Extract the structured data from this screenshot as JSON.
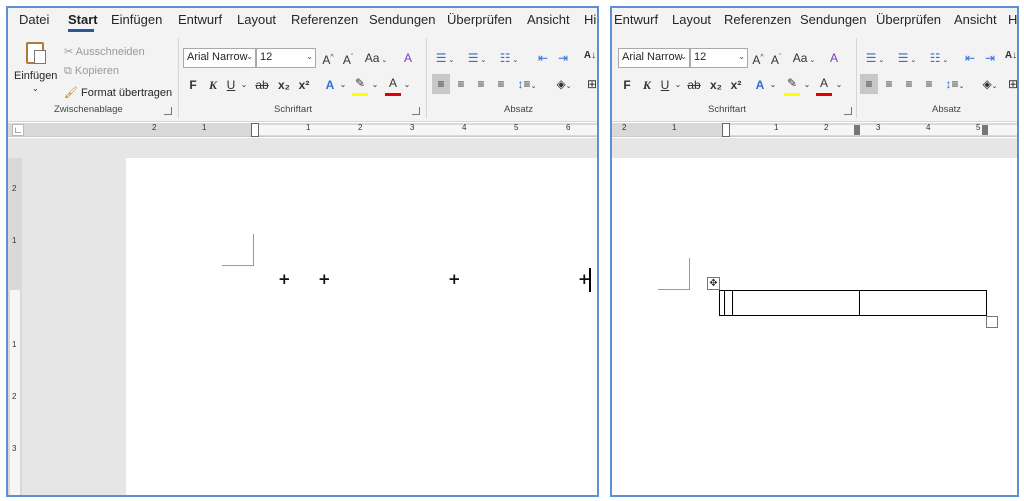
{
  "left": {
    "tabs": [
      "Datei",
      "Start",
      "Einfügen",
      "Entwurf",
      "Layout",
      "Referenzen",
      "Sendungen",
      "Überprüfen",
      "Ansicht",
      "Hil"
    ],
    "active_tab": "Start",
    "clipboard": {
      "paste_label": "Einfügen",
      "cut_label": "Ausschneiden",
      "copy_label": "Kopieren",
      "format_label": "Format übertragen",
      "group_label": "Zwischenablage"
    },
    "font": {
      "name": "Arial Narrow",
      "size": "12",
      "group_label": "Schriftart",
      "bold_glyph": "F",
      "italic_glyph": "K",
      "underline_glyph": "U",
      "strike_glyph": "ab",
      "sub_glyph": "x₂",
      "sup_glyph": "x²",
      "grow_glyph": "A^",
      "shrink_glyph": "Aˇ",
      "case_glyph": "Aa",
      "clear_glyph": "A",
      "effect_glyph": "A",
      "highlight_glyph": "✎",
      "color_glyph": "A"
    },
    "paragraph": {
      "group_label": "Absatz"
    },
    "ruler_numbers": [
      "2",
      "1",
      "1",
      "2",
      "3",
      "4",
      "5",
      "6"
    ],
    "vruler_numbers": [
      "2",
      "1",
      "1",
      "2",
      "3"
    ]
  },
  "right": {
    "tabs": [
      "Entwurf",
      "Layout",
      "Referenzen",
      "Sendungen",
      "Überprüfen",
      "Ansicht",
      "Hi"
    ],
    "font": {
      "name": "Arial Narrow",
      "size": "12",
      "group_label": "Schriftart"
    },
    "paragraph": {
      "group_label": "Absatz"
    },
    "ruler_numbers": [
      "2",
      "1",
      "1",
      "2",
      "3",
      "4",
      "5"
    ]
  },
  "colors": {
    "accent": "#2b579a",
    "window_border": "#5b8fd6",
    "highlight_yellow": "#ffff00",
    "font_red": "#e00000",
    "ribbon_bg": "#f3f3f3"
  }
}
